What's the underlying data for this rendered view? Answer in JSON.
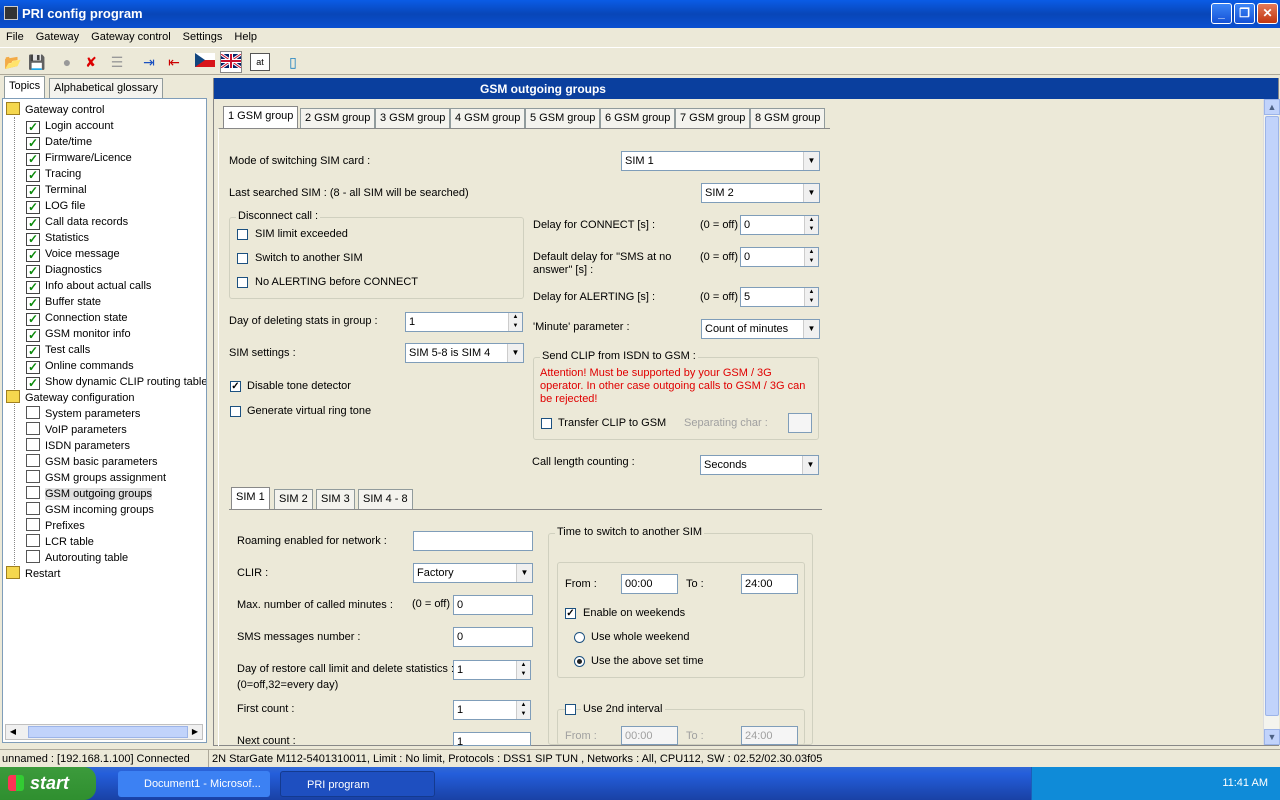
{
  "window": {
    "title": "PRI config program"
  },
  "menu": [
    "File",
    "Gateway",
    "Gateway control",
    "Settings",
    "Help"
  ],
  "left_tabs": [
    "Topics",
    "Alphabetical glossary"
  ],
  "tree": {
    "gateway_control": "Gateway control",
    "control_items": [
      "Login account",
      "Date/time",
      "Firmware/Licence",
      "Tracing",
      "Terminal",
      "LOG file",
      "Call data records",
      "Statistics",
      "Voice message",
      "Diagnostics",
      "Info about actual calls",
      "Buffer state",
      "Connection state",
      "GSM monitor info",
      "Test calls",
      "Online commands",
      "Show dynamic CLIP routing table"
    ],
    "gateway_config": "Gateway configuration",
    "config_items": [
      "System parameters",
      "VoIP parameters",
      "ISDN parameters",
      "GSM basic parameters",
      "GSM groups assignment",
      "GSM outgoing groups",
      "GSM incoming groups",
      "Prefixes",
      "LCR table",
      "Autorouting table"
    ],
    "restart": "Restart"
  },
  "panel": {
    "title": "GSM outgoing groups"
  },
  "group_tabs": [
    "1 GSM group",
    "2 GSM group",
    "3 GSM group",
    "4 GSM group",
    "5 GSM group",
    "6 GSM group",
    "7 GSM group",
    "8 GSM group"
  ],
  "form": {
    "mode_label": "Mode of switching SIM card :",
    "mode_value": "SIM 1",
    "last_label": "Last searched SIM : (8 - all SIM will be searched)",
    "last_value": "SIM 2",
    "disconnect_legend": "Disconnect call :",
    "sim_limit": "SIM limit exceeded",
    "switch_sim": "Switch to another SIM",
    "no_alerting": "No ALERTING before CONNECT",
    "delay_connect": "Delay for CONNECT [s] :",
    "zero_off": "(0 = off)",
    "delay_connect_val": "0",
    "default_delay": "Default delay for \"SMS at no answer\" [s] :",
    "default_delay_val": "0",
    "delay_alerting": "Delay for ALERTING [s] :",
    "delay_alerting_val": "5",
    "day_del": "Day of deleting stats in group :",
    "day_del_val": "1",
    "minute_param": "'Minute' parameter :",
    "minute_val": "Count of minutes",
    "sim_settings": "SIM settings :",
    "sim_settings_val": "SIM 5-8 is SIM 4",
    "clip_legend": "Send CLIP from ISDN to GSM :",
    "clip_warn": "Attention! Must be supported by your GSM / 3G operator. In other case outgoing calls to GSM / 3G can be rejected!",
    "transfer_clip": "Transfer CLIP to GSM",
    "sep_char": "Separating char :",
    "disable_tone": "Disable tone detector",
    "virtual_ring": "Generate virtual ring tone",
    "call_length": "Call length counting :",
    "call_length_val": "Seconds"
  },
  "sim_tabs": [
    "SIM 1",
    "SIM 2",
    "SIM 3",
    "SIM 4 - 8"
  ],
  "sim": {
    "roaming": "Roaming enabled for network :",
    "clir": "CLIR :",
    "clir_val": "Factory",
    "max_min": "Max. number of called minutes :",
    "zero_off": "(0 = off)",
    "max_min_val": "0",
    "sms": "SMS messages number :",
    "sms_val": "0",
    "restore": "Day of restore call limit and delete statistics :",
    "restore2": "(0=off,32=every day)",
    "restore_val": "1",
    "first": "First count :",
    "first_val": "1",
    "next": "Next count :",
    "next_val": "1",
    "switch_legend": "Time to switch to another SIM",
    "from": "From :",
    "from_val": "00:00",
    "to": "To :",
    "to_val": "24:00",
    "weekends": "Enable on weekends",
    "whole": "Use whole weekend",
    "above": "Use the above set time",
    "second": "Use 2nd interval",
    "from2": "00:00",
    "to2": "24:00"
  },
  "status": {
    "left": "unnamed : [192.168.1.100] Connected",
    "right": "2N StarGate M112-5401310011, Limit : No limit, Protocols : DSS1 SIP TUN , Networks : All, CPU112, SW : 02.52/02.30.03f05"
  },
  "taskbar": {
    "start": "start",
    "tasks": [
      "Document1 - Microsof...",
      "PRI program"
    ],
    "clock": "11:41 AM"
  }
}
